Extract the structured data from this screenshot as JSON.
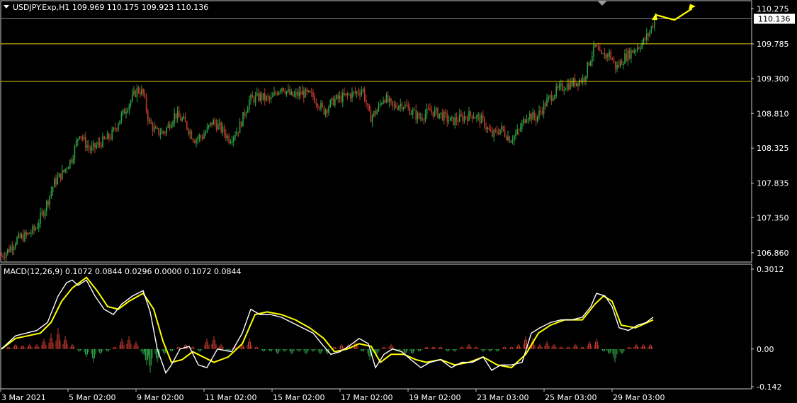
{
  "chart_title": "USDJPY.Exp,H1  109.969 110.175 109.923 110.136",
  "macd_title": "MACD(12,26,9) 0.1072 0.0844 0.0296 0.0000 0.1072 0.0844",
  "current_price_label": "110.136",
  "colors": {
    "background": "#000000",
    "bull": "#2ea043",
    "bear": "#c0392b",
    "level_line": "#e6d200",
    "macd_line": "#ffffff",
    "signal_line": "#ffff00",
    "arrow": "#ffff00",
    "frame": "#c8c8c8"
  },
  "chart_data": [
    {
      "type": "candlestick",
      "symbol": "USDJPY.Exp",
      "timeframe": "H1",
      "ohlc_last": {
        "open": 109.969,
        "high": 110.175,
        "low": 109.923,
        "close": 110.136
      },
      "ylim": [
        106.73,
        110.3
      ],
      "y_ticks": [
        "110.275",
        "109.785",
        "109.300",
        "108.810",
        "108.325",
        "107.835",
        "107.350",
        "106.860"
      ],
      "x_ticks": [
        "3 Mar 2021",
        "5 Mar 02:00",
        "9 Mar 02:00",
        "11 Mar 02:00",
        "15 Mar 02:00",
        "17 Mar 02:00",
        "19 Mar 02:00",
        "23 Mar 03:00",
        "25 Mar 03:00",
        "29 Mar 03:00"
      ],
      "horizontal_levels": [
        109.785,
        109.26
      ],
      "current_price": 110.136,
      "close_path": [
        [
          0,
          106.82
        ],
        [
          10,
          106.9
        ],
        [
          22,
          107.05
        ],
        [
          35,
          107.1
        ],
        [
          48,
          107.2
        ],
        [
          62,
          107.5
        ],
        [
          75,
          107.85
        ],
        [
          88,
          108.0
        ],
        [
          100,
          108.2
        ],
        [
          110,
          108.55
        ],
        [
          118,
          108.4
        ],
        [
          126,
          108.3
        ],
        [
          140,
          108.4
        ],
        [
          155,
          108.5
        ],
        [
          168,
          108.75
        ],
        [
          180,
          108.95
        ],
        [
          192,
          109.15
        ],
        [
          200,
          109.1
        ],
        [
          208,
          108.7
        ],
        [
          218,
          108.55
        ],
        [
          230,
          108.55
        ],
        [
          245,
          108.8
        ],
        [
          258,
          108.7
        ],
        [
          272,
          108.45
        ],
        [
          285,
          108.5
        ],
        [
          298,
          108.7
        ],
        [
          310,
          108.6
        ],
        [
          322,
          108.45
        ],
        [
          335,
          108.6
        ],
        [
          350,
          109.0
        ],
        [
          365,
          109.05
        ],
        [
          380,
          109.0
        ],
        [
          395,
          109.2
        ],
        [
          410,
          109.05
        ],
        [
          425,
          109.1
        ],
        [
          440,
          109.05
        ],
        [
          455,
          108.85
        ],
        [
          470,
          109.0
        ],
        [
          485,
          109.05
        ],
        [
          500,
          109.1
        ],
        [
          510,
          109.15
        ],
        [
          520,
          108.75
        ],
        [
          530,
          108.85
        ],
        [
          540,
          109.05
        ],
        [
          552,
          108.9
        ],
        [
          565,
          108.95
        ],
        [
          578,
          108.85
        ],
        [
          590,
          108.75
        ],
        [
          605,
          108.85
        ],
        [
          620,
          108.8
        ],
        [
          635,
          108.7
        ],
        [
          650,
          108.75
        ],
        [
          665,
          108.8
        ],
        [
          680,
          108.7
        ],
        [
          692,
          108.5
        ],
        [
          705,
          108.6
        ],
        [
          718,
          108.45
        ],
        [
          730,
          108.55
        ],
        [
          742,
          108.8
        ],
        [
          755,
          108.75
        ],
        [
          768,
          108.95
        ],
        [
          780,
          109.1
        ],
        [
          795,
          109.2
        ],
        [
          810,
          109.25
        ],
        [
          822,
          109.3
        ],
        [
          830,
          109.55
        ],
        [
          838,
          109.75
        ],
        [
          846,
          109.6
        ],
        [
          858,
          109.65
        ],
        [
          868,
          109.45
        ],
        [
          880,
          109.6
        ],
        [
          892,
          109.7
        ],
        [
          905,
          109.8
        ],
        [
          915,
          109.95
        ],
        [
          922,
          110.136
        ]
      ]
    },
    {
      "type": "macd",
      "params": "12,26,9",
      "values": {
        "macd_1": 0.1072,
        "signal_1": 0.0844,
        "hist": 0.0296,
        "zero": 0.0,
        "macd_2": 0.1072,
        "signal_2": 0.0844
      },
      "ylim": [
        -0.142,
        0.3012
      ],
      "y_ticks": [
        "0.3012",
        "0.00",
        "-0.142"
      ],
      "macd_path": [
        [
          0,
          0.0
        ],
        [
          20,
          0.05
        ],
        [
          50,
          0.07
        ],
        [
          65,
          0.1
        ],
        [
          80,
          0.2
        ],
        [
          92,
          0.25
        ],
        [
          100,
          0.26
        ],
        [
          108,
          0.24
        ],
        [
          120,
          0.26
        ],
        [
          132,
          0.2
        ],
        [
          145,
          0.15
        ],
        [
          158,
          0.13
        ],
        [
          170,
          0.17
        ],
        [
          185,
          0.2
        ],
        [
          200,
          0.22
        ],
        [
          210,
          0.14
        ],
        [
          220,
          0.0
        ],
        [
          232,
          -0.09
        ],
        [
          240,
          -0.06
        ],
        [
          252,
          0.0
        ],
        [
          265,
          0.01
        ],
        [
          278,
          -0.06
        ],
        [
          290,
          -0.07
        ],
        [
          305,
          0.0
        ],
        [
          325,
          -0.01
        ],
        [
          340,
          0.06
        ],
        [
          352,
          0.15
        ],
        [
          365,
          0.13
        ],
        [
          380,
          0.13
        ],
        [
          395,
          0.12
        ],
        [
          410,
          0.1
        ],
        [
          425,
          0.08
        ],
        [
          440,
          0.06
        ],
        [
          452,
          0.02
        ],
        [
          465,
          -0.02
        ],
        [
          478,
          -0.01
        ],
        [
          490,
          0.01
        ],
        [
          505,
          0.04
        ],
        [
          518,
          0.02
        ],
        [
          528,
          -0.07
        ],
        [
          540,
          -0.02
        ],
        [
          552,
          0.0
        ],
        [
          565,
          -0.01
        ],
        [
          578,
          -0.04
        ],
        [
          592,
          -0.07
        ],
        [
          605,
          -0.05
        ],
        [
          620,
          -0.04
        ],
        [
          635,
          -0.07
        ],
        [
          650,
          -0.05
        ],
        [
          665,
          -0.05
        ],
        [
          680,
          -0.03
        ],
        [
          692,
          -0.08
        ],
        [
          705,
          -0.06
        ],
        [
          720,
          -0.06
        ],
        [
          735,
          -0.05
        ],
        [
          748,
          0.06
        ],
        [
          760,
          0.08
        ],
        [
          775,
          0.1
        ],
        [
          790,
          0.11
        ],
        [
          805,
          0.11
        ],
        [
          820,
          0.12
        ],
        [
          832,
          0.16
        ],
        [
          840,
          0.21
        ],
        [
          852,
          0.2
        ],
        [
          862,
          0.16
        ],
        [
          872,
          0.08
        ],
        [
          885,
          0.07
        ],
        [
          898,
          0.09
        ],
        [
          910,
          0.1
        ],
        [
          920,
          0.12
        ]
      ],
      "signal_path": [
        [
          0,
          0.0
        ],
        [
          20,
          0.04
        ],
        [
          55,
          0.06
        ],
        [
          70,
          0.1
        ],
        [
          85,
          0.18
        ],
        [
          100,
          0.23
        ],
        [
          120,
          0.27
        ],
        [
          135,
          0.22
        ],
        [
          150,
          0.16
        ],
        [
          165,
          0.15
        ],
        [
          180,
          0.18
        ],
        [
          200,
          0.21
        ],
        [
          215,
          0.15
        ],
        [
          228,
          0.03
        ],
        [
          240,
          -0.05
        ],
        [
          255,
          -0.04
        ],
        [
          270,
          -0.01
        ],
        [
          285,
          -0.03
        ],
        [
          300,
          -0.05
        ],
        [
          320,
          -0.03
        ],
        [
          340,
          0.02
        ],
        [
          358,
          0.13
        ],
        [
          375,
          0.14
        ],
        [
          395,
          0.13
        ],
        [
          415,
          0.11
        ],
        [
          435,
          0.08
        ],
        [
          455,
          0.04
        ],
        [
          470,
          -0.01
        ],
        [
          488,
          0.0
        ],
        [
          505,
          0.02
        ],
        [
          522,
          0.01
        ],
        [
          535,
          -0.05
        ],
        [
          550,
          -0.02
        ],
        [
          568,
          -0.02
        ],
        [
          585,
          -0.04
        ],
        [
          600,
          -0.05
        ],
        [
          620,
          -0.04
        ],
        [
          640,
          -0.06
        ],
        [
          660,
          -0.05
        ],
        [
          680,
          -0.03
        ],
        [
          700,
          -0.06
        ],
        [
          720,
          -0.07
        ],
        [
          740,
          -0.02
        ],
        [
          758,
          0.06
        ],
        [
          775,
          0.09
        ],
        [
          795,
          0.11
        ],
        [
          820,
          0.11
        ],
        [
          838,
          0.17
        ],
        [
          850,
          0.2
        ],
        [
          862,
          0.18
        ],
        [
          875,
          0.09
        ],
        [
          895,
          0.08
        ],
        [
          920,
          0.11
        ]
      ],
      "histogram": [
        [
          10,
          0.01
        ],
        [
          20,
          0.02
        ],
        [
          30,
          0.015
        ],
        [
          40,
          0.02
        ],
        [
          50,
          0.02
        ],
        [
          60,
          0.04
        ],
        [
          70,
          0.06
        ],
        [
          80,
          0.08
        ],
        [
          90,
          0.05
        ],
        [
          100,
          0.02
        ],
        [
          110,
          -0.01
        ],
        [
          120,
          -0.03
        ],
        [
          130,
          -0.05
        ],
        [
          140,
          -0.02
        ],
        [
          150,
          -0.01
        ],
        [
          160,
          0.01
        ],
        [
          170,
          0.04
        ],
        [
          180,
          0.05
        ],
        [
          190,
          0.03
        ],
        [
          200,
          -0.02
        ],
        [
          205,
          -0.06
        ],
        [
          210,
          -0.09
        ],
        [
          220,
          -0.05
        ],
        [
          230,
          -0.02
        ],
        [
          240,
          -0.01
        ],
        [
          250,
          0.01
        ],
        [
          260,
          0.02
        ],
        [
          270,
          0.01
        ],
        [
          280,
          -0.01
        ],
        [
          290,
          0.04
        ],
        [
          300,
          0.05
        ],
        [
          310,
          0.02
        ],
        [
          320,
          -0.01
        ],
        [
          330,
          0.01
        ],
        [
          340,
          0.02
        ],
        [
          350,
          0.04
        ],
        [
          360,
          0.01
        ],
        [
          370,
          -0.01
        ],
        [
          380,
          -0.01
        ],
        [
          390,
          -0.02
        ],
        [
          400,
          -0.01
        ],
        [
          410,
          -0.02
        ],
        [
          420,
          -0.01
        ],
        [
          430,
          -0.02
        ],
        [
          440,
          -0.01
        ],
        [
          450,
          -0.02
        ],
        [
          460,
          -0.02
        ],
        [
          470,
          0.01
        ],
        [
          480,
          0.02
        ],
        [
          490,
          0.02
        ],
        [
          500,
          0.03
        ],
        [
          510,
          -0.01
        ],
        [
          520,
          -0.04
        ],
        [
          530,
          -0.02
        ],
        [
          540,
          0.01
        ],
        [
          550,
          0.02
        ],
        [
          560,
          -0.01
        ],
        [
          570,
          -0.02
        ],
        [
          580,
          -0.02
        ],
        [
          590,
          -0.01
        ],
        [
          600,
          0.01
        ],
        [
          610,
          0.01
        ],
        [
          620,
          0.01
        ],
        [
          630,
          -0.01
        ],
        [
          640,
          -0.01
        ],
        [
          650,
          0.01
        ],
        [
          660,
          0.02
        ],
        [
          670,
          0.01
        ],
        [
          680,
          -0.01
        ],
        [
          690,
          -0.01
        ],
        [
          700,
          -0.01
        ],
        [
          710,
          0.01
        ],
        [
          720,
          0.01
        ],
        [
          730,
          0.02
        ],
        [
          740,
          0.05
        ],
        [
          750,
          0.04
        ],
        [
          760,
          0.02
        ],
        [
          770,
          0.03
        ],
        [
          780,
          0.02
        ],
        [
          790,
          0.01
        ],
        [
          800,
          0.01
        ],
        [
          810,
          0.02
        ],
        [
          820,
          0.01
        ],
        [
          830,
          0.03
        ],
        [
          840,
          0.04
        ],
        [
          850,
          -0.01
        ],
        [
          858,
          -0.02
        ],
        [
          866,
          -0.05
        ],
        [
          876,
          -0.02
        ],
        [
          886,
          0.01
        ],
        [
          896,
          0.02
        ],
        [
          906,
          0.02
        ],
        [
          916,
          0.02
        ]
      ]
    }
  ]
}
